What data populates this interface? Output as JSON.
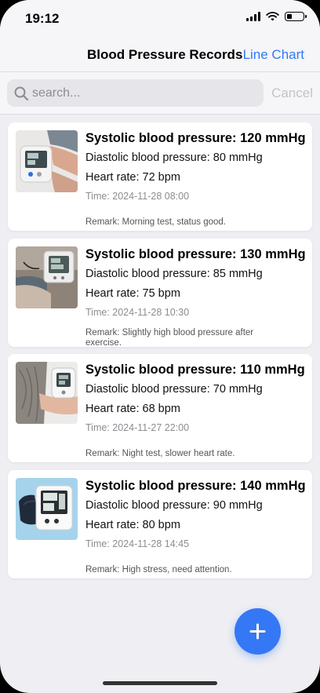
{
  "status_bar": {
    "time": "19:12",
    "battery_level": 0.35
  },
  "nav": {
    "title": "Blood Pressure Records",
    "action_label": "Line Chart"
  },
  "search": {
    "placeholder": "search...",
    "value": "",
    "cancel_label": "Cancel"
  },
  "records": [
    {
      "systolic": "Systolic blood pressure: 120 mmHg",
      "diastolic": "Diastolic blood pressure: 80 mmHg",
      "heart_rate": "Heart rate: 72 bpm",
      "time": "Time: 2024-11-28 08:00",
      "remark": "Remark: Morning test, status good."
    },
    {
      "systolic": "Systolic blood pressure: 130 mmHg",
      "diastolic": "Diastolic blood pressure: 85 mmHg",
      "heart_rate": "Heart rate: 75 bpm",
      "time": "Time: 2024-11-28 10:30",
      "remark": "Remark: Slightly high blood pressure after exercise."
    },
    {
      "systolic": "Systolic blood pressure: 110 mmHg",
      "diastolic": "Diastolic blood pressure: 70 mmHg",
      "heart_rate": "Heart rate: 68 bpm",
      "time": "Time: 2024-11-27 22:00",
      "remark": "Remark: Night test, slower heart rate."
    },
    {
      "systolic": "Systolic blood pressure: 140 mmHg",
      "diastolic": "Diastolic blood pressure: 90 mmHg",
      "heart_rate": "Heart rate: 80 bpm",
      "time": "Time: 2024-11-28 14:45",
      "remark": "Remark: High stress, need attention."
    }
  ],
  "fab": {
    "icon": "plus-icon"
  },
  "colors": {
    "accent": "#3478f6",
    "link": "#2f7af5",
    "background": "#eeeef3"
  }
}
